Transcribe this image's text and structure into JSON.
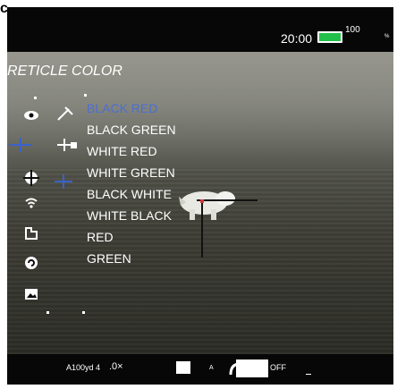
{
  "corner_glyph": "c",
  "status": {
    "time": "20:00",
    "battery_percent": "100",
    "battery_unit": "%",
    "battery_level": 1.0,
    "battery_color": "#22c04a"
  },
  "menu": {
    "title": "RETICLE COLOR",
    "selected_index": 0,
    "selected_color": "#4b6fd2",
    "options": [
      "BLACK RED",
      "BLACK GREEN",
      "WHITE RED",
      "WHITE GREEN",
      "BLACK WHITE",
      "WHITE BLACK",
      "RED",
      "GREEN"
    ]
  },
  "sidebar_icons": [
    "eye-icon",
    "calibration-icon",
    "crosshair-icon",
    "wifi-icon",
    "storage-icon",
    "refresh-icon",
    "gallery-icon"
  ],
  "bottom_bar": {
    "profile": "A100yd 4",
    "zoom": ".0×",
    "mode_letter": "A",
    "pip_state": "OFF"
  }
}
